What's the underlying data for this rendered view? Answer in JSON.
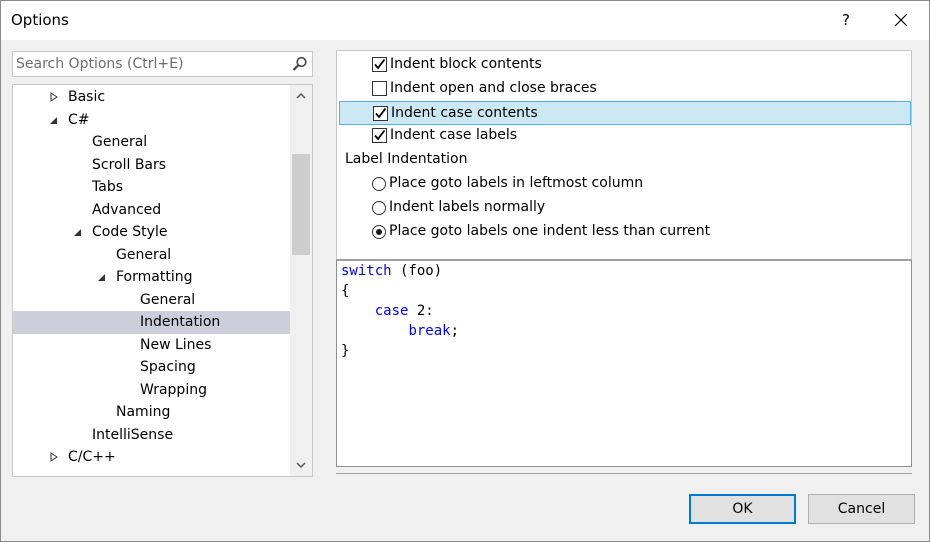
{
  "window": {
    "title": "Options",
    "help_label": "?"
  },
  "search": {
    "placeholder": "Search Options (Ctrl+E)"
  },
  "tree": {
    "items": [
      {
        "label": "Basic",
        "level": 1,
        "arrow": "collapsed"
      },
      {
        "label": "C#",
        "level": 1,
        "arrow": "expanded"
      },
      {
        "label": "General",
        "level": 2,
        "arrow": "none"
      },
      {
        "label": "Scroll Bars",
        "level": 2,
        "arrow": "none"
      },
      {
        "label": "Tabs",
        "level": 2,
        "arrow": "none"
      },
      {
        "label": "Advanced",
        "level": 2,
        "arrow": "none"
      },
      {
        "label": "Code Style",
        "level": 2,
        "arrow": "expanded"
      },
      {
        "label": "General",
        "level": 3,
        "arrow": "none"
      },
      {
        "label": "Formatting",
        "level": 3,
        "arrow": "expanded"
      },
      {
        "label": "General",
        "level": 4,
        "arrow": "none"
      },
      {
        "label": "Indentation",
        "level": 4,
        "arrow": "none",
        "selected": true
      },
      {
        "label": "New Lines",
        "level": 4,
        "arrow": "none"
      },
      {
        "label": "Spacing",
        "level": 4,
        "arrow": "none"
      },
      {
        "label": "Wrapping",
        "level": 4,
        "arrow": "none"
      },
      {
        "label": "Naming",
        "level": 3,
        "arrow": "none"
      },
      {
        "label": "IntelliSense",
        "level": 2,
        "arrow": "none"
      },
      {
        "label": "C/C++",
        "level": 1,
        "arrow": "collapsed"
      }
    ]
  },
  "options": {
    "checkboxes": [
      {
        "label": "Indent block contents",
        "checked": true
      },
      {
        "label": "Indent open and close braces",
        "checked": false
      },
      {
        "label": "Indent case contents",
        "checked": true,
        "highlighted": true
      },
      {
        "label": "Indent case labels",
        "checked": true
      }
    ],
    "group_label": "Label Indentation",
    "radios": [
      {
        "label": "Place goto labels in leftmost column",
        "selected": false
      },
      {
        "label": "Indent labels normally",
        "selected": false
      },
      {
        "label": "Place goto labels one indent less than current",
        "selected": true
      }
    ]
  },
  "preview": {
    "lines": [
      [
        {
          "text": "switch",
          "kw": true
        },
        {
          "text": " (foo)"
        }
      ],
      [
        {
          "text": "{"
        }
      ],
      [
        {
          "text": "    "
        },
        {
          "text": "case",
          "kw": true
        },
        {
          "text": " 2:"
        }
      ],
      [
        {
          "text": "        "
        },
        {
          "text": "break",
          "kw": true
        },
        {
          "text": ";"
        }
      ],
      [
        {
          "text": "}"
        }
      ]
    ]
  },
  "buttons": {
    "ok_label": "OK",
    "cancel_label": "Cancel"
  },
  "colors": {
    "keyword": "#0000ff",
    "selection": "#cccedb",
    "highlight": "#cce8f4",
    "focus": "#0078d7"
  }
}
